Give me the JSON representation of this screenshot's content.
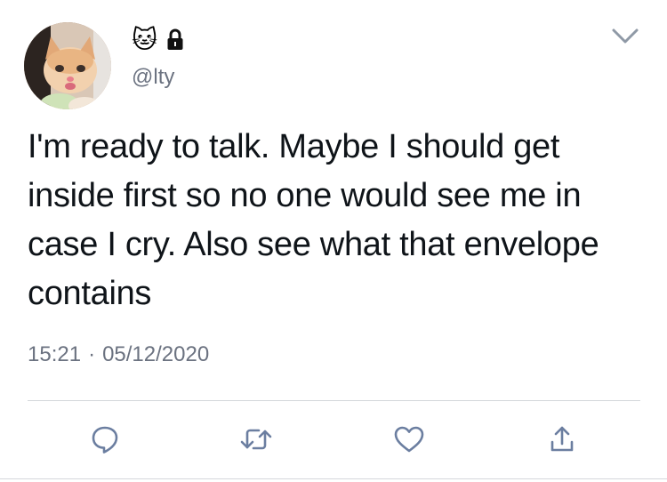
{
  "header": {
    "display_name": "🐱",
    "handle": "@lty",
    "avatar_icon": "crying-cat-avatar",
    "lock_icon": "lock-icon",
    "menu_icon": "chevron-down-icon"
  },
  "tweet": {
    "text": "I'm ready to talk. Maybe I should get inside first so no one would see me in case I cry. Also see what that envelope contains",
    "time": "15:21",
    "separator": "·",
    "date": "05/12/2020"
  },
  "actions": {
    "reply_icon": "reply-icon",
    "retweet_icon": "retweet-icon",
    "like_icon": "heart-icon",
    "share_icon": "share-icon"
  },
  "colors": {
    "text": "#0f1419",
    "secondary": "#6b7280",
    "icon": "#6b7ea0",
    "divider": "#d4d7db"
  }
}
